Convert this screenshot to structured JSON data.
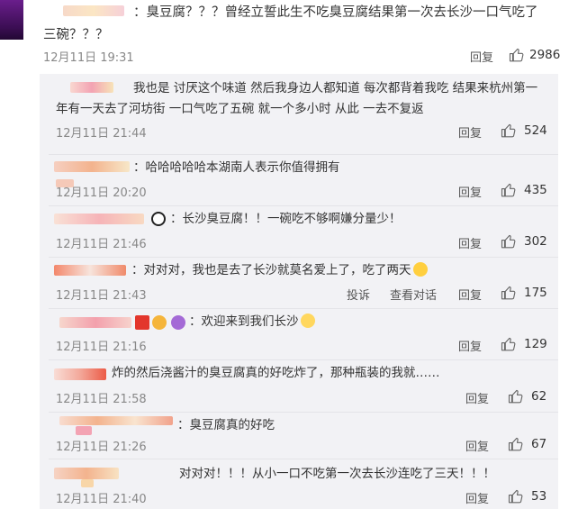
{
  "top_comment": {
    "text": "：臭豆腐？？？曾经立誓此生不吃臭豆腐结果第一次去长沙一口气吃了三碗？？？",
    "date": "12月11日 19:31",
    "reply_label": "回复",
    "likes": "2986"
  },
  "replies": [
    {
      "text": "我也是 讨厌这个味道 然后我身边人都知道 每次都背着我吃 结果来杭州第一年有一天去了河坊街 一口气吃了五碗 就一个多小时 从此 一去不复返",
      "date": "12月11日 21:44",
      "reply_label": "回复",
      "likes": "524"
    },
    {
      "text": "：哈哈哈哈哈本湖南人表示你值得拥有",
      "date": "12月11日 20:20",
      "reply_label": "回复",
      "likes": "435"
    },
    {
      "text": "：长沙臭豆腐！！一碗吃不够啊嫌分量少！",
      "date": "12月11日 21:46",
      "reply_label": "回复",
      "likes": "302"
    },
    {
      "text": "：对对对，我也是去了长沙就莫名爱上了，吃了两天",
      "date": "12月11日 21:43",
      "report_label": "投诉",
      "conversation_label": "查看对话",
      "reply_label": "回复",
      "likes": "175"
    },
    {
      "text": "：欢迎来到我们长沙",
      "date": "12月11日 21:16",
      "reply_label": "回复",
      "likes": "129"
    },
    {
      "text": "炸的然后浇酱汁的臭豆腐真的好吃炸了，那种瓶装的我就……",
      "date": "12月11日 21:58",
      "reply_label": "回复",
      "likes": "62"
    },
    {
      "text": "：臭豆腐真的好吃",
      "date": "12月11日 21:26",
      "reply_label": "回复",
      "likes": "67"
    },
    {
      "text": "对对对！！！从小一口不吃第一次去长沙连吃了三天！！！",
      "date": "12月11日 21:40",
      "reply_label": "回复",
      "likes": "53"
    }
  ],
  "colors": {
    "accent": "#eb7350",
    "reply_bg": "#f2f2f5",
    "muted": "#888888"
  },
  "icons": {
    "like": "thumbs-up-icon"
  }
}
